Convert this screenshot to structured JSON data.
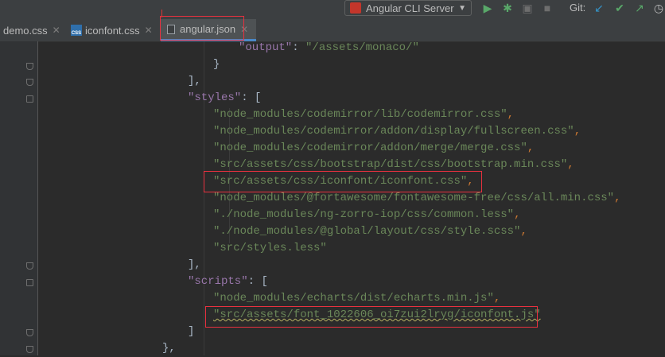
{
  "toolbar": {
    "run_config": "Angular CLI Server",
    "git_label": "Git:"
  },
  "tabs": [
    {
      "label": "demo.css"
    },
    {
      "label": "iconfont.css"
    },
    {
      "label": "angular.json"
    }
  ],
  "code": {
    "line1_key": "\"output\"",
    "line1_val": "\"/assets/monaco/\"",
    "line2": "}",
    "line3": "],",
    "styles_key": "\"styles\"",
    "styles_open": "[",
    "styles": [
      "\"node_modules/codemirror/lib/codemirror.css\"",
      "\"node_modules/codemirror/addon/display/fullscreen.css\"",
      "\"node_modules/codemirror/addon/merge/merge.css\"",
      "\"src/assets/css/bootstrap/dist/css/bootstrap.min.css\"",
      "\"src/assets/css/iconfont/iconfont.css\"",
      "\"node_modules/@fortawesome/fontawesome-free/css/all.min.css\"",
      "\"./node_modules/ng-zorro-iop/css/common.less\"",
      "\"./node_modules/@global/layout/css/style.scss\"",
      "\"src/styles.less\""
    ],
    "styles_close": "],",
    "scripts_key": "\"scripts\"",
    "scripts_open": "[",
    "scripts": [
      "\"node_modules/echarts/dist/echarts.min.js\"",
      "\"src/assets/font_1022606_oi7zui2lryg/iconfont.js\""
    ],
    "scripts_close": "]",
    "last": "},"
  },
  "colors": {
    "background": "#2b2b2b",
    "string": "#6a8759",
    "key": "#9876aa",
    "punctuation": "#cc7832",
    "highlight": "#e8313f"
  }
}
